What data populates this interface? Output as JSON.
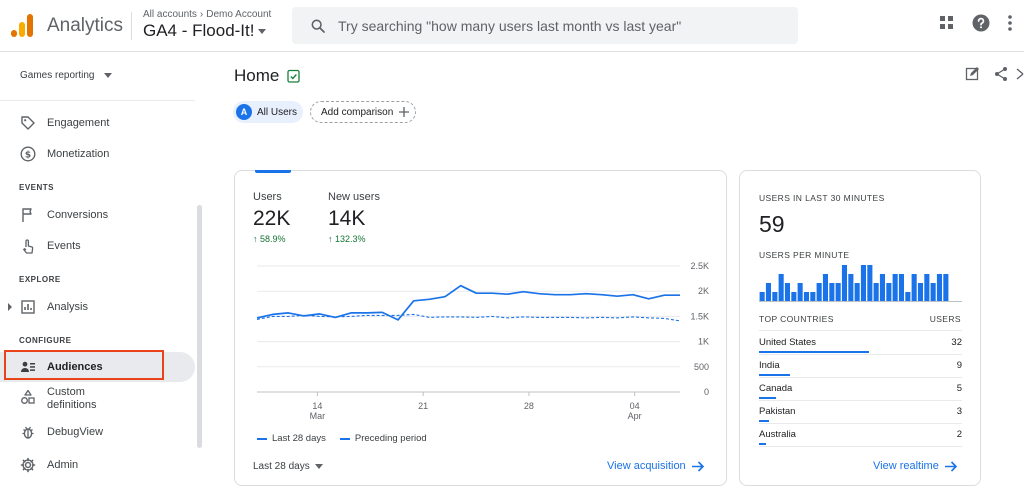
{
  "header": {
    "app_name": "Analytics",
    "breadcrumb": [
      "All accounts",
      "Demo Account"
    ],
    "breadcrumb_sep": "›",
    "property": "GA4 - Flood-It!",
    "search_placeholder": "Try searching \"how many users last month vs last year\""
  },
  "sidebar": {
    "report_selector": "Games reporting",
    "items": {
      "engagement": "Engagement",
      "monetization": "Monetization",
      "conversions": "Conversions",
      "events": "Events",
      "analysis": "Analysis",
      "audiences": "Audiences",
      "custom_definitions_1": "Custom",
      "custom_definitions_2": "definitions",
      "debugview": "DebugView",
      "admin": "Admin"
    },
    "sections": {
      "events": "EVENTS",
      "explore": "EXPLORE",
      "configure": "CONFIGURE"
    }
  },
  "main": {
    "title": "Home",
    "comparison": {
      "avatar_letter": "A",
      "label": "All Users",
      "add_label": "Add comparison"
    },
    "overview": {
      "metrics": [
        {
          "label": "Users",
          "value": "22K",
          "delta": "↑ 58.9%"
        },
        {
          "label": "New users",
          "value": "14K",
          "delta": "↑ 132.3%"
        }
      ],
      "legend": {
        "current": "Last 28 days",
        "previous": "Preceding period"
      },
      "range_label": "Last 28 days",
      "link": "View acquisition"
    },
    "realtime": {
      "heading": "USERS IN LAST 30 MINUTES",
      "value": "59",
      "per_minute": "USERS PER MINUTE",
      "countries_heading": "TOP COUNTRIES",
      "users_heading": "USERS",
      "countries": [
        {
          "name": "United States",
          "users": "32"
        },
        {
          "name": "India",
          "users": "9"
        },
        {
          "name": "Canada",
          "users": "5"
        },
        {
          "name": "Pakistan",
          "users": "3"
        },
        {
          "name": "Australia",
          "users": "2"
        }
      ],
      "link": "View realtime"
    }
  },
  "chart_data": [
    {
      "type": "line",
      "x_ticks": [
        {
          "day": 14,
          "label": "14",
          "sublabel": "Mar"
        },
        {
          "day": 21,
          "label": "21",
          "sublabel": ""
        },
        {
          "day": 28,
          "label": "28",
          "sublabel": ""
        },
        {
          "day": 35,
          "label": "04",
          "sublabel": "Apr"
        }
      ],
      "y_ticks": [
        "2.5K",
        "2K",
        "1.5K",
        "1K",
        "500",
        "0"
      ],
      "ylim": [
        0,
        2500
      ],
      "x_range": [
        10,
        38
      ],
      "series": [
        {
          "name": "Last 28 days",
          "style": "solid",
          "color": "#1a73e8",
          "values": [
            1470,
            1540,
            1570,
            1510,
            1550,
            1480,
            1570,
            1570,
            1580,
            1430,
            1810,
            1840,
            1890,
            2110,
            1960,
            1960,
            1940,
            1990,
            1950,
            1930,
            1930,
            1950,
            1930,
            1900,
            1930,
            1850,
            1920,
            1920
          ]
        },
        {
          "name": "Preceding period",
          "style": "dashed",
          "color": "#1a73e8",
          "values": [
            1440,
            1500,
            1500,
            1520,
            1500,
            1490,
            1500,
            1520,
            1520,
            1520,
            1540,
            1480,
            1490,
            1490,
            1480,
            1500,
            1470,
            1490,
            1480,
            1480,
            1480,
            1470,
            1480,
            1470,
            1490,
            1470,
            1460,
            1410
          ]
        }
      ]
    },
    {
      "type": "bar",
      "title": "USERS PER MINUTE",
      "values": [
        1,
        2,
        1,
        3,
        2,
        1,
        2,
        1,
        1,
        2,
        3,
        2,
        2,
        4,
        3,
        2,
        4,
        4,
        2,
        3,
        2,
        3,
        3,
        1,
        3,
        2,
        3,
        2,
        3,
        3
      ]
    }
  ]
}
